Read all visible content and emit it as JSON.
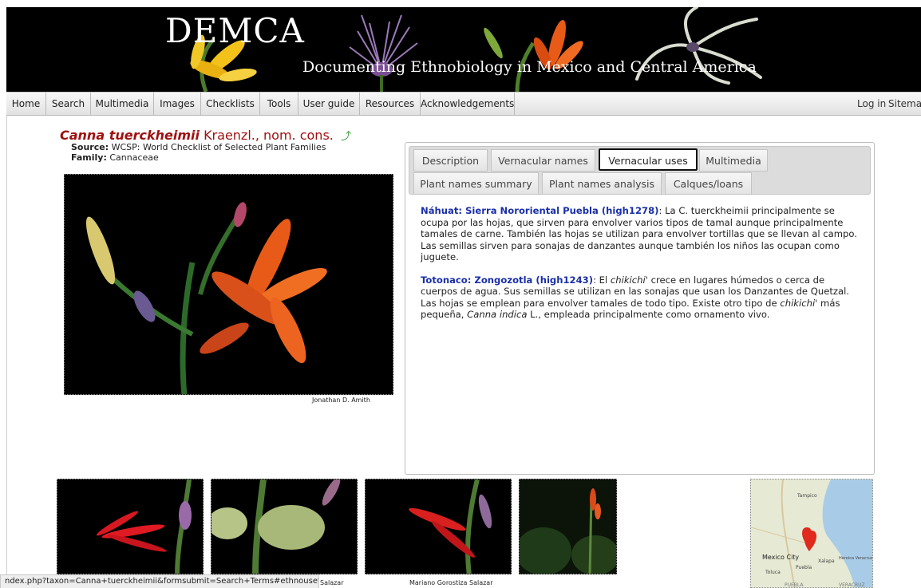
{
  "banner": {
    "title": "DEMCA",
    "subtitle": "Documenting Ethnobiology in Mexico and Central America"
  },
  "nav": {
    "items": [
      "Home",
      "Search",
      "Multimedia",
      "Images",
      "Checklists",
      "Tools",
      "User guide",
      "Resources",
      "Acknowledgements"
    ],
    "login": "Log in",
    "sitemap": "Sitemap"
  },
  "taxon": {
    "scientific_name": "Canna tuerckheimii",
    "authority": "Kraenzl., nom. cons.",
    "source_label": "Source:",
    "source_value": "WCSP: World Checklist of Selected Plant Families",
    "family_label": "Family:",
    "family_value": "Cannaceae"
  },
  "main_photo": {
    "credit": "Jonathan D. Amith"
  },
  "tabs": {
    "row1": [
      "Description",
      "Vernacular names",
      "Vernacular uses",
      "Multimedia"
    ],
    "row2": [
      "Plant names summary",
      "Plant names analysis",
      "Calques/loans"
    ],
    "active": "Vernacular uses"
  },
  "uses": [
    {
      "label": "Náhuat: Sierra Nororiental Puebla (high1278)",
      "text": ": La C. tuerckheimii principalmente se ocupa por las hojas, que sirven para envolver varios tipos de tamal aunque principalmente tamales de carne. También las hojas se utilizan para envolver tortillas que se llevan al campo. Las semillas sirven para sonajas de danzantes aunque también los niños las ocupan como juguete."
    },
    {
      "label": "Totonaco: Zongozotla (high1243)",
      "t1": ": El ",
      "i1": "chikichi'",
      "t2": " crece en lugares húmedos o cerca de cuerpos de agua. Sus semillas se utilizan en las sonajas que usan los Danzantes de Quetzal. Las hojas se emplean para envolver tamales de todo tipo. Existe otro tipo de ",
      "i2": "chikichi'",
      "t3": " más pequeña, ",
      "i3": "Canna indica",
      "t4": " L., empleada principalmente como ornamento vivo."
    }
  ],
  "thumb_credits": {
    "first_partial": "Salazar",
    "second": "Mariano Gorostiza Salazar"
  },
  "map": {
    "labels": [
      "Tampico",
      "Mexico City",
      "Toluca",
      "Puebla",
      "Xalapa",
      "Heroica Veracruz",
      "PUEBLA",
      "VERACRUZ"
    ]
  },
  "status_bar": {
    "url": "ndex.php?taxon=Canna+tuerckheimii&formsubmit=Search+Terms#ethnousetab"
  },
  "colors": {
    "taxon_name": "#a01010",
    "entry_label": "#1a2fa8",
    "nav_bg": "#e8e8e8"
  }
}
